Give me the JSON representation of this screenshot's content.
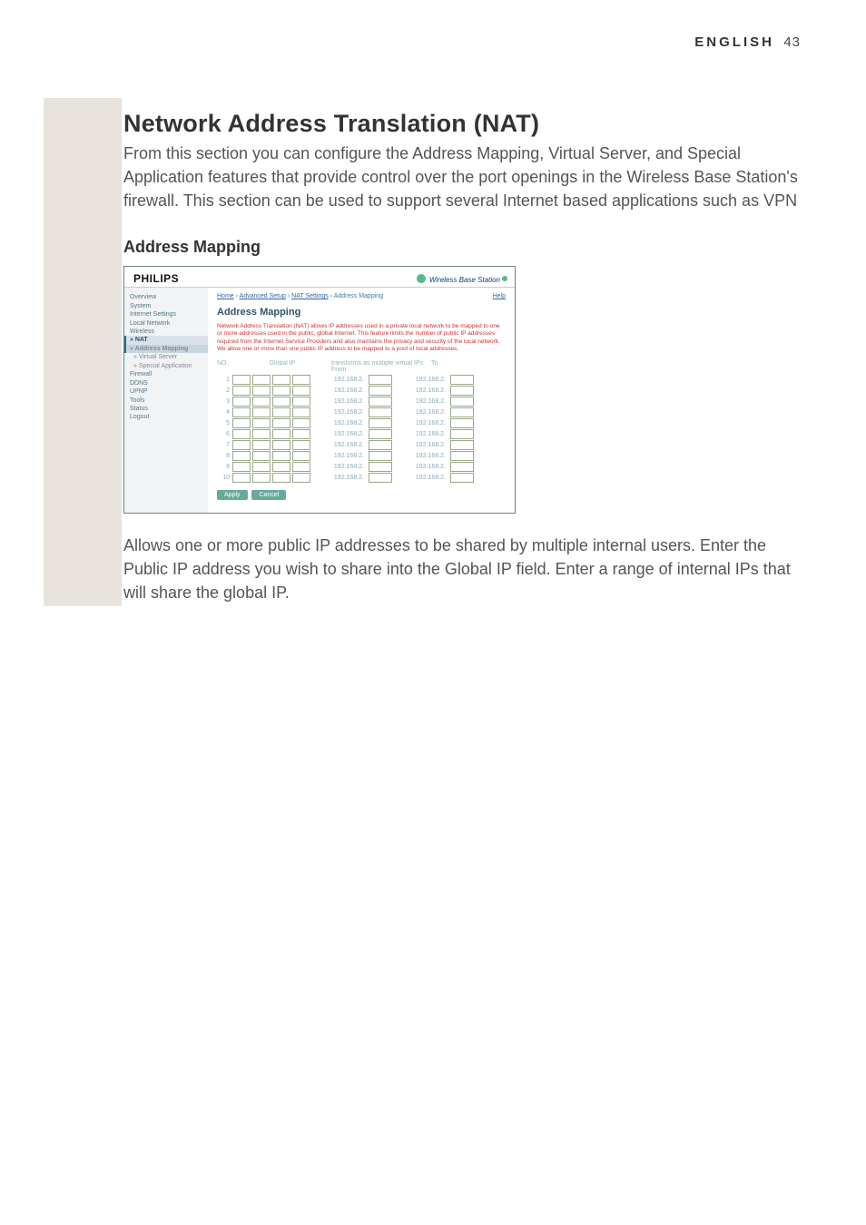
{
  "page": {
    "language": "ENGLISH",
    "number": "43"
  },
  "heading": "Network Address Translation (NAT)",
  "intro": "From this section you can configure the Address Mapping, Virtual Server, and Special Application features that provide control over the port openings in the Wireless Base Station's firewall. This section can be used to support several Internet based applications such as VPN",
  "subheading": "Address Mapping",
  "screenshot": {
    "brand": "PHILIPS",
    "tagline": "Wireless Base Station",
    "nav": [
      {
        "label": "Overview"
      },
      {
        "label": "System"
      },
      {
        "label": "Internet Settings"
      },
      {
        "label": "Local Network"
      },
      {
        "label": "Wireless"
      },
      {
        "label": "» NAT",
        "current": true
      },
      {
        "label": "» Address Mapping",
        "sub": true,
        "current": true
      },
      {
        "label": "» Virtual Server",
        "sub": true
      },
      {
        "label": "» Special Application",
        "sub": true
      },
      {
        "label": "Firewall"
      },
      {
        "label": "DDNS"
      },
      {
        "label": "UPNP"
      },
      {
        "label": "Tools"
      },
      {
        "label": "Status"
      },
      {
        "label": "Logout"
      }
    ],
    "breadcrumb": {
      "a": "Home",
      "b": "Advanced Setup",
      "c": "NAT Settings",
      "d": "Address Mapping"
    },
    "help": "Help",
    "title": "Address Mapping",
    "description": "Network Address Translation (NAT) allows IP addresses used in a private local network to be mapped to one or more addresses used in the public, global Internet. This feature limits the number of public IP addresses required from the Internet Service Providers and also maintains the privacy and security of the local network. We allow one or more than one public IP address to be mapped to a pool of local addresses.",
    "columns": {
      "no": "NO.",
      "gip": "Global IP",
      "mid": "transforms as multiple virtual IPs From",
      "to": "To"
    },
    "prefix": "192.168.2.",
    "rows": [
      "1",
      "2",
      "3",
      "4",
      "5",
      "6",
      "7",
      "8",
      "9",
      "10"
    ],
    "buttons": {
      "apply": "Apply",
      "cancel": "Cancel"
    }
  },
  "outro": "Allows one or more public IP addresses to be shared by multiple internal users. Enter the Public IP address you wish to share into the Global IP field. Enter a range of internal IPs that will share the global IP."
}
